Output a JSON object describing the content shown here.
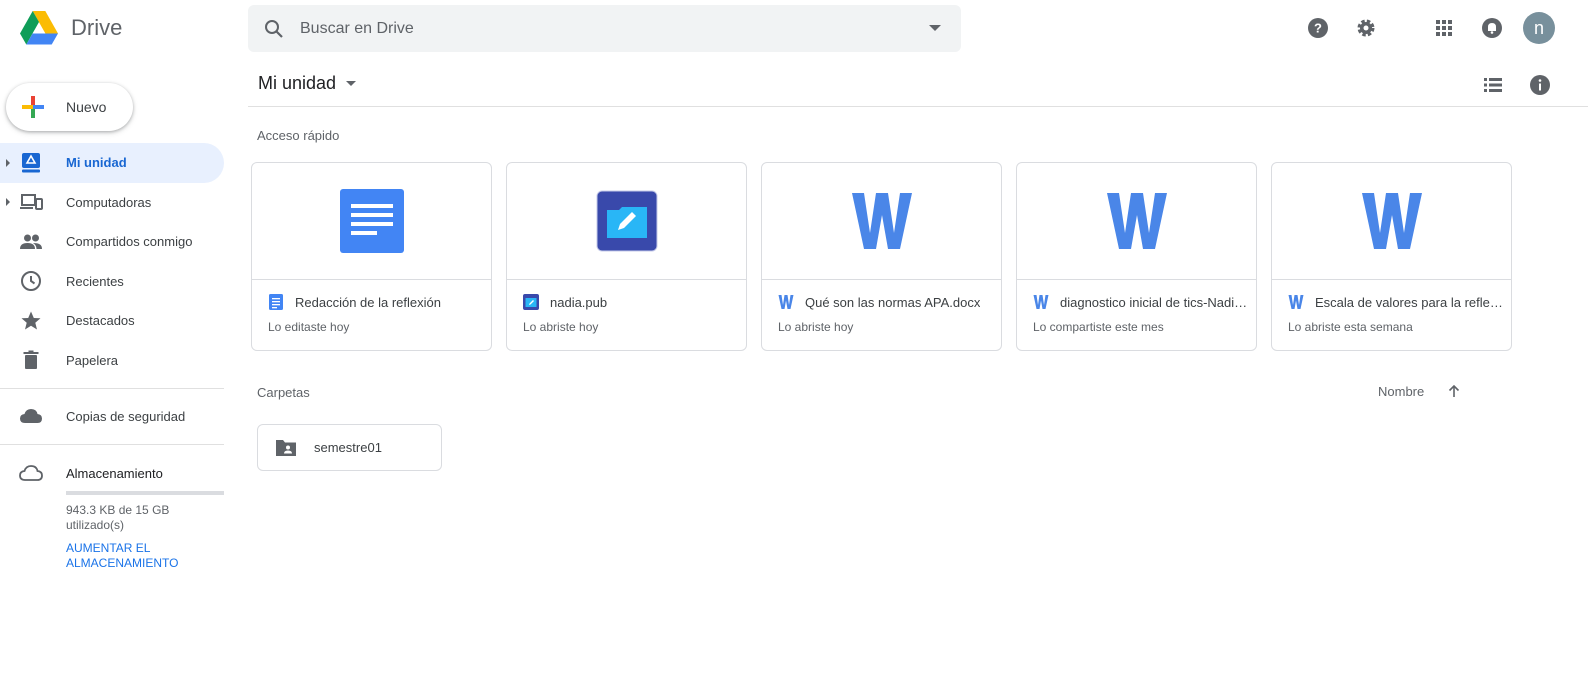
{
  "app": {
    "name": "Drive"
  },
  "search": {
    "placeholder": "Buscar en Drive"
  },
  "header": {
    "avatar_letter": "n",
    "avatar_color": "#78909c"
  },
  "sidebar": {
    "new_label": "Nuevo",
    "items": [
      {
        "label": "Mi unidad",
        "icon": "my-drive-icon",
        "active": true
      },
      {
        "label": "Computadoras",
        "icon": "computers-icon"
      },
      {
        "label": "Compartidos conmigo",
        "icon": "shared-icon"
      },
      {
        "label": "Recientes",
        "icon": "clock-icon"
      },
      {
        "label": "Destacados",
        "icon": "star-icon"
      },
      {
        "label": "Papelera",
        "icon": "trash-icon"
      }
    ],
    "backup_label": "Copias de seguridad",
    "storage": {
      "title": "Almacenamiento",
      "used_text": "943.3 KB de 15 GB utilizado(s)",
      "used_fraction": 0.0001,
      "upgrade_link": "AUMENTAR EL ALMACENAMIENTO"
    }
  },
  "main": {
    "breadcrumb": "Mi unidad",
    "quick_access": {
      "title": "Acceso rápido",
      "cards": [
        {
          "title": "Redacción de la reflexión",
          "subtitle": "Lo editaste hoy",
          "type": "docs"
        },
        {
          "title": "nadia.pub",
          "subtitle": "Lo abriste hoy",
          "type": "publisher"
        },
        {
          "title": "Qué son las normas APA.docx",
          "subtitle": "Lo abriste hoy",
          "type": "word"
        },
        {
          "title": "diagnostico inicial de tics-Nadia.docx",
          "subtitle": "Lo compartiste este mes",
          "type": "word"
        },
        {
          "title": "Escala de valores para la reflexión.docx",
          "subtitle": "Lo abriste esta semana",
          "type": "word"
        }
      ]
    },
    "folders": {
      "title": "Carpetas",
      "sort_label": "Nombre",
      "items": [
        {
          "name": "semestre01"
        }
      ]
    }
  },
  "colors": {
    "accent": "#1a73e8",
    "active_bg": "#e8f0fe",
    "word_blue": "#4a86e8",
    "docs_blue": "#4285f4"
  }
}
